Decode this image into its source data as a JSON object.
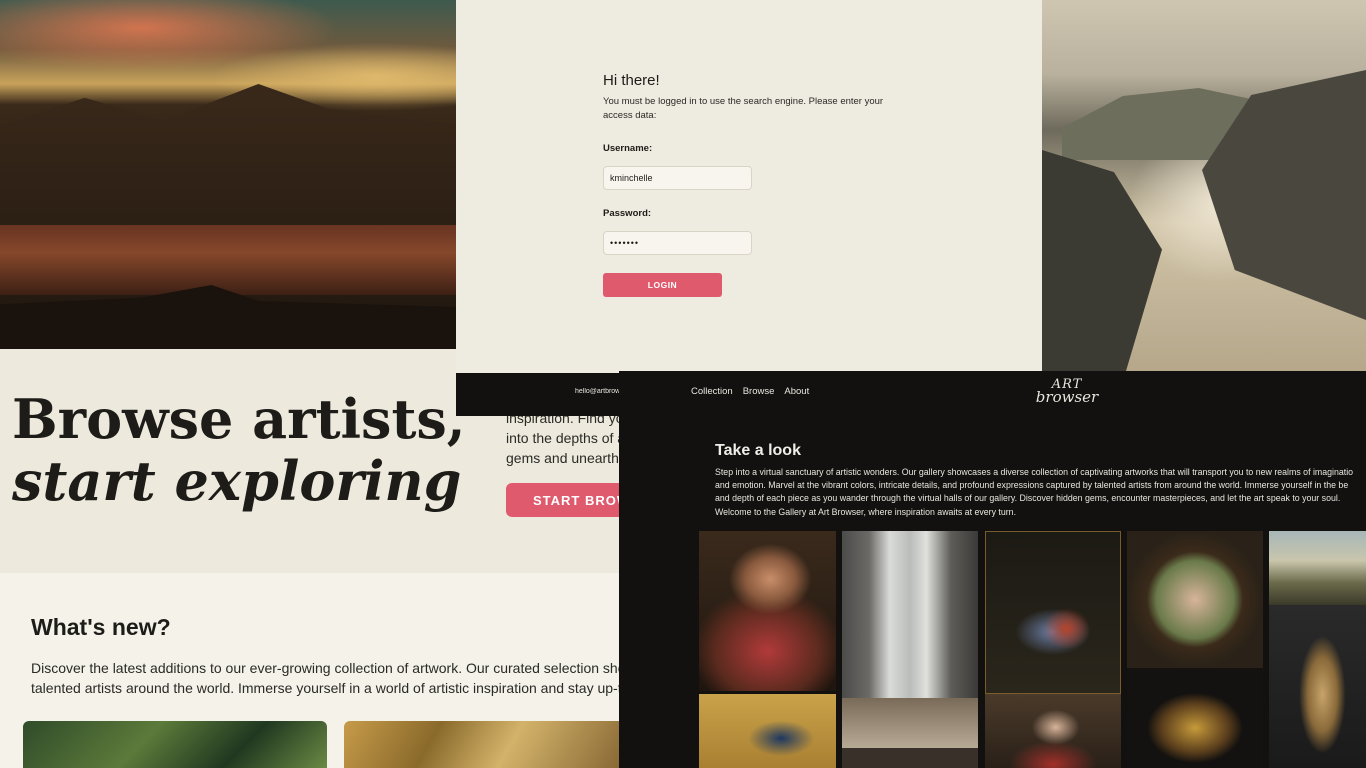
{
  "hero": {
    "title_line1": "Browse artists,",
    "title_line2": "start exploring",
    "snippet_lines": [
      "inspiration. Find yo",
      "into the depths of a",
      "gems and unearth r"
    ],
    "cta_label": "START BROWS"
  },
  "whats_new": {
    "title": "What's new?",
    "text_lines": [
      "Discover the latest additions to our ever-growing collection of artwork. Our curated selection showcas",
      "talented artists around the world. Immerse yourself in a world of artistic inspiration and stay up-to-dat"
    ]
  },
  "login": {
    "greeting": "Hi there!",
    "description": "You must be logged in to use the search engine. Please enter your access data:",
    "username_label": "Username:",
    "username_value": "kminchelle",
    "password_label": "Password:",
    "password_value": "•••••••",
    "button_label": "LOGIN",
    "footer_email": "hello@artbrow"
  },
  "gallery": {
    "nav": [
      "Collection",
      "Browse",
      "About"
    ],
    "logo_line1": "ART",
    "logo_line2": "browser",
    "title": "Take a look",
    "text_lines": [
      "Step into a virtual sanctuary of artistic wonders. Our gallery showcases a diverse collection of captivating artworks that will transport you to new realms of imaginatio",
      "and emotion. Marvel at the vibrant colors, intricate details, and profound expressions captured by talented artists from around the world. Immerse yourself in the be",
      "and depth of each piece as you wander through the virtual halls of our gallery. Discover hidden gems, encounter masterpieces, and let the art speak to your soul.",
      "Welcome to the Gallery at Art Browser, where inspiration awaits at every turn."
    ]
  },
  "colors": {
    "accent": "#e05a6d",
    "dark_bg": "#12110f",
    "light_bg": "#edeadd",
    "panel_bg": "#eeebe0"
  }
}
